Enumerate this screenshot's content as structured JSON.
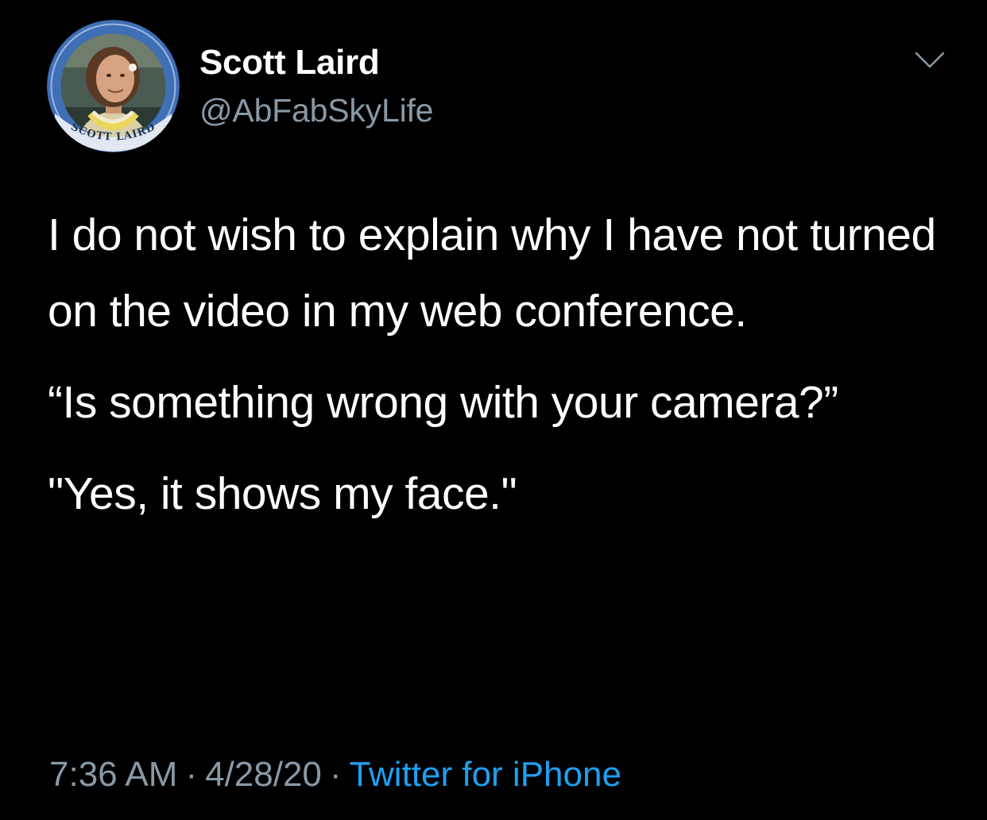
{
  "author": {
    "display_name": "Scott Laird",
    "handle": "@AbFabSkyLife",
    "avatar_banner_text": "SCOTT LAIRD"
  },
  "icons": {
    "more": "chevron-down-icon"
  },
  "tweet": {
    "paragraphs": [
      "I do not wish to explain why I have not turned on the video in my web conference.",
      "“Is something wrong with your camera?”",
      "\"Yes, it shows my face.\""
    ]
  },
  "meta": {
    "time": "7:36 AM",
    "separator": "·",
    "date": "4/28/20",
    "source": "Twitter for iPhone"
  },
  "colors": {
    "background": "#000000",
    "text_primary": "#ffffff",
    "text_secondary": "#8899a6",
    "link": "#1da1f2",
    "avatar_ring": "#3f6fb5"
  }
}
